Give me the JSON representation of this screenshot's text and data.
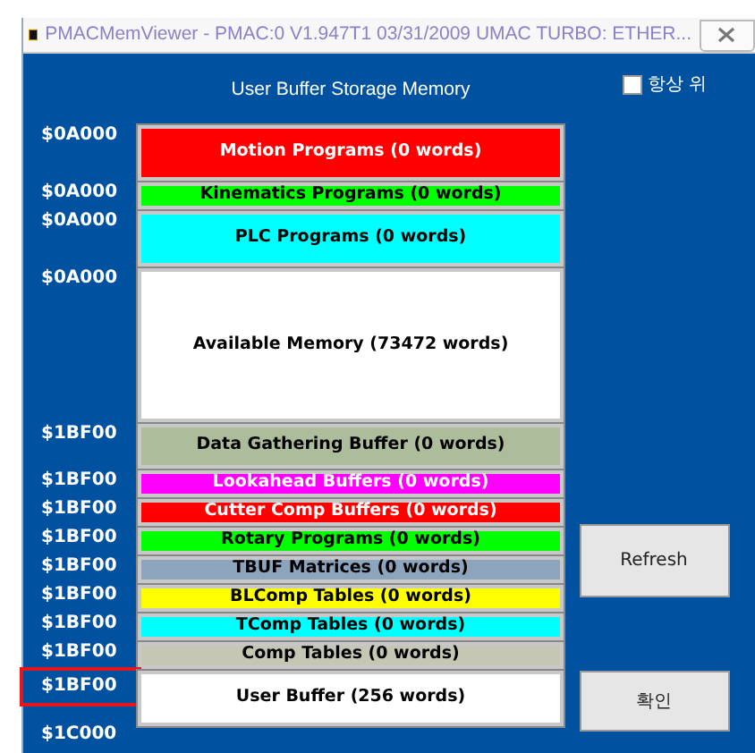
{
  "window": {
    "title": "PMACMemViewer - PMAC:0 V1.947T1 03/31/2009 UMAC TURBO: ETHER..."
  },
  "heading": "User Buffer Storage Memory",
  "always_on_top": {
    "label": "항상 위",
    "checked": false
  },
  "blocks": [
    {
      "address": "$0A000",
      "label": "Motion Programs (0 words)",
      "color": "#ff0000",
      "kind": "tall"
    },
    {
      "address": "$0A000",
      "label": "Kinematics Programs (0 words)",
      "color": "#00ff00",
      "kind": "short"
    },
    {
      "address": "$0A000",
      "label": "PLC Programs (0 words)",
      "color": "#00ffff",
      "kind": "tall"
    },
    {
      "address": "$0A000",
      "label": "Available Memory (73472 words)",
      "color": "#ffffff",
      "kind": "free"
    },
    {
      "address": "$1BF00",
      "label": "Data Gathering Buffer (0 words)",
      "color": "#adbd9c",
      "kind": "mid"
    },
    {
      "address": "$1BF00",
      "label": "Lookahead Buffers (0 words)",
      "color": "#ff00ff",
      "kind": "short"
    },
    {
      "address": "$1BF00",
      "label": "Cutter Comp Buffers (0 words)",
      "color": "#ff0000",
      "kind": "short"
    },
    {
      "address": "$1BF00",
      "label": "Rotary Programs (0 words)",
      "color": "#00ff00",
      "kind": "short"
    },
    {
      "address": "$1BF00",
      "label": "TBUF Matrices (0 words)",
      "color": "#8ca5bd",
      "kind": "short"
    },
    {
      "address": "$1BF00",
      "label": "BLComp Tables (0 words)",
      "color": "#ffff00",
      "kind": "short"
    },
    {
      "address": "$1BF00",
      "label": "TComp Tables (0 words)",
      "color": "#00ffff",
      "kind": "short"
    },
    {
      "address": "$1BF00",
      "label": "Comp Tables (0 words)",
      "color": "#c6c6b5",
      "kind": "short"
    },
    {
      "address": "$1BF00",
      "label": "User Buffer (256 words)",
      "color": "#ffffff",
      "kind": "tall",
      "highlighted": true
    }
  ],
  "end_address": "$1C000",
  "buttons": [
    {
      "label": "Refresh"
    },
    {
      "label": "확인"
    }
  ]
}
